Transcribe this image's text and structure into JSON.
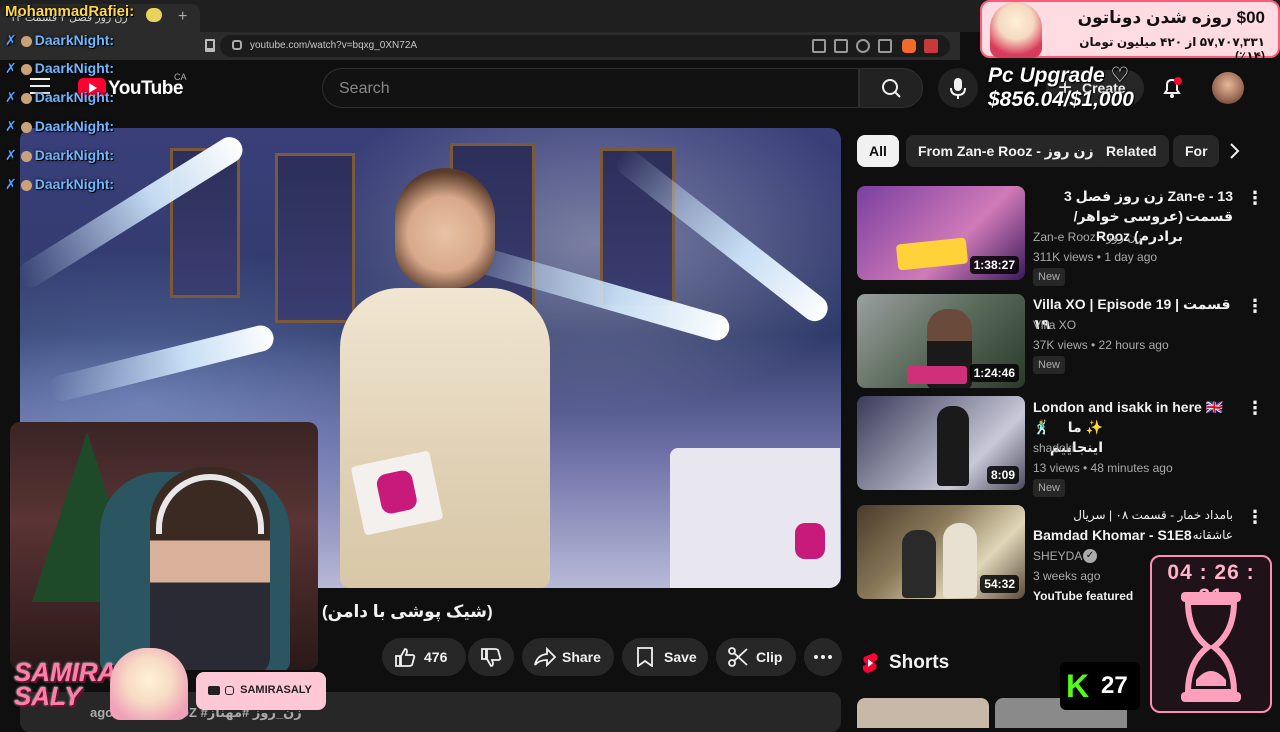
{
  "browser": {
    "tab_title": "زن روز فصل ۳ قسمت ۱۴",
    "tab_close": "×",
    "new_tab": "+",
    "url": "youtube.com/watch?v=bqxg_0XN72A"
  },
  "header": {
    "logo_text": "YouTube",
    "country": "CA",
    "search_placeholder": "Search",
    "create_label": "Create"
  },
  "video": {
    "title": "(شیک پوشی با دامن)",
    "likes": "476",
    "share_label": "Share",
    "save_label": "Save",
    "clip_label": "Clip",
    "description_snippet": "ago #ZANEROOZ #زن_روز #مهناز"
  },
  "chips": [
    {
      "label": "All",
      "active": true
    },
    {
      "label": "From Zan-e Rooz - زن روز",
      "active": false
    },
    {
      "label": "Related",
      "active": false
    },
    {
      "label": "For",
      "active": false
    }
  ],
  "recommendations": [
    {
      "title": "Zan-e - 13 زن روز فصل 3 قسمت",
      "title2": "(عروسی خواهر/برادرم) Rooz",
      "channel": "Zan-e Rooz - زن روز",
      "views": "311K views • 1 day ago",
      "badge": "New",
      "duration": "1:38:27",
      "colors": [
        "#7a3fa0",
        "#d07ab8"
      ]
    },
    {
      "title": "Villa XO | Episode 19 | قسمت ۱۹",
      "title2": "",
      "channel": "Villa XO",
      "views": "37K views • 22 hours ago",
      "badge": "New",
      "duration": "1:24:46",
      "colors": [
        "#8a8f8a",
        "#3a5a3a"
      ]
    },
    {
      "title": "London and isakk in here 🇬🇧🕺",
      "title2": "✨ ما اینجاییم",
      "channel": "shadoki",
      "views": "13 views • 48 minutes ago",
      "badge": "New",
      "duration": "8:09",
      "colors": [
        "#5a5a6a",
        "#b0b0c0"
      ]
    },
    {
      "title": "بامداد خمار - قسمت ۰۸ | سریال عاشقانه",
      "title2": "Bamdad Khomar - S1E8",
      "channel": "SHEYDA",
      "views": "3 weeks ago",
      "badge": "YouTube featured",
      "duration": "54:32",
      "colors": [
        "#6a5a3a",
        "#d8c8a0"
      ]
    }
  ],
  "shorts": {
    "label": "Shorts"
  },
  "overlay": {
    "streamer_name": "MohammadRafiei:",
    "chat": [
      {
        "user": "DaarkNight:"
      },
      {
        "user": "DaarkNight:"
      },
      {
        "user": "DaarkNight:"
      },
      {
        "user": "DaarkNight:"
      },
      {
        "user": "DaarkNight:"
      },
      {
        "user": "DaarkNight:"
      }
    ],
    "donation_title": "روزه شدن دوناتون",
    "donation_amount": "$00",
    "donation_sub": "۵۷,۷۰۷,۳۳۱ از ۴۲۰ میلیون تومان (۱۴٪)",
    "goal_text": "Pc Upgrade ♡ $856.04/$1,000",
    "webcam_brand": "SAMIRA SALY",
    "webcam_handle": "SAMIRASALY",
    "kick_count": "27",
    "timer": "04 : 26 : 21"
  },
  "colors": {
    "accent_red": "#ff0033",
    "chip_active_bg": "#f1f1f1",
    "kick_green": "#53fc18",
    "timer_pink": "#ffb3c8"
  }
}
